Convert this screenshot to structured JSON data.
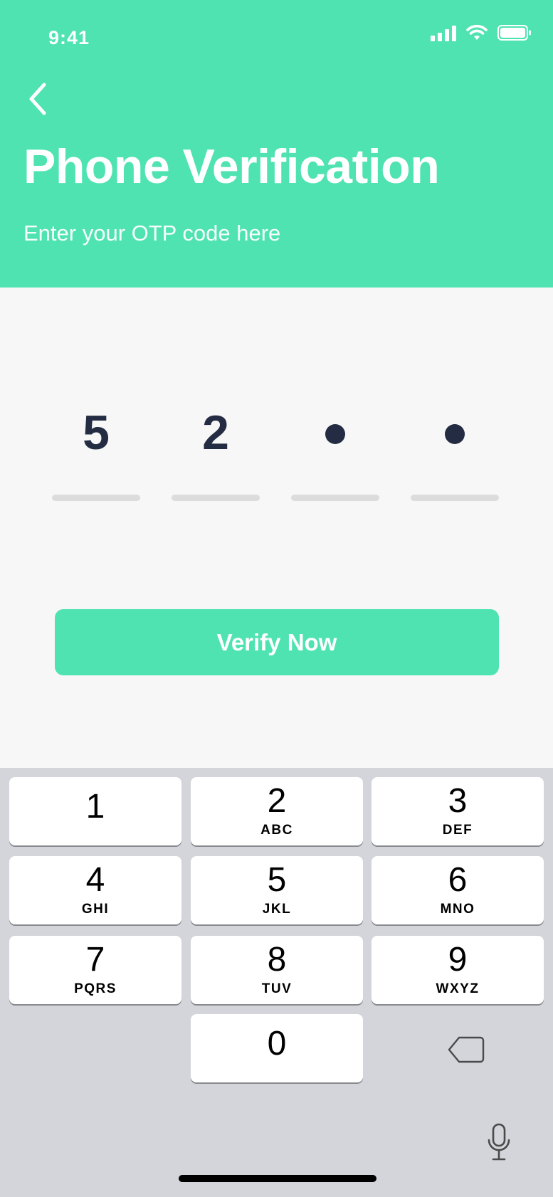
{
  "status_bar": {
    "time": "9:41"
  },
  "header": {
    "title": "Phone Verification",
    "subtitle": "Enter your OTP code here"
  },
  "otp": {
    "digits": [
      "5",
      "2",
      "",
      ""
    ],
    "filled_count": 2,
    "total_slots": 4
  },
  "verify_button": {
    "label": "Verify Now"
  },
  "keypad": {
    "keys": [
      {
        "num": "1",
        "letters": ""
      },
      {
        "num": "2",
        "letters": "ABC"
      },
      {
        "num": "3",
        "letters": "DEF"
      },
      {
        "num": "4",
        "letters": "GHI"
      },
      {
        "num": "5",
        "letters": "JKL"
      },
      {
        "num": "6",
        "letters": "MNO"
      },
      {
        "num": "7",
        "letters": "PQRS"
      },
      {
        "num": "8",
        "letters": "TUV"
      },
      {
        "num": "9",
        "letters": "WXYZ"
      },
      {
        "num": "0",
        "letters": ""
      }
    ]
  },
  "icons": {
    "back": "chevron-left-icon",
    "signal": "cellular-signal-icon",
    "wifi": "wifi-icon",
    "battery": "battery-icon",
    "delete": "backspace-icon",
    "mic": "microphone-icon"
  },
  "colors": {
    "accent": "#4fe3b2",
    "background": "#f7f7f7",
    "digit": "#232c42",
    "underline": "#dcdcdc",
    "keyboard_bg": "#d3d5da"
  }
}
